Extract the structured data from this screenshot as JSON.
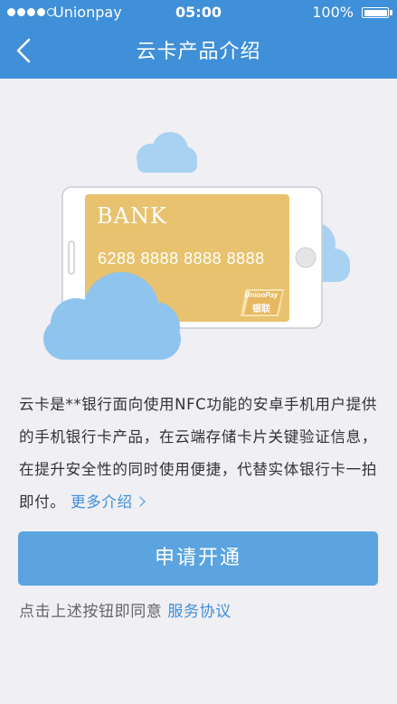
{
  "status_bar": {
    "carrier": "Unionpay",
    "time": "05:00",
    "battery": "100%"
  },
  "nav": {
    "title": "云卡产品介绍"
  },
  "card": {
    "bank_name": "BANK",
    "number": "6288 8888 8888 8888",
    "logo_en": "UnionPay",
    "logo_cn": "银联"
  },
  "description": {
    "text": "云卡是**银行面向使用NFC功能的安卓手机用户提供的手机银行卡产品，在云端存储卡片关键验证信息，在提升安全性的同时使用便捷，代替实体银行卡一拍即付。",
    "more_link": "更多介绍"
  },
  "actions": {
    "apply_label": "申请开通"
  },
  "agreement": {
    "text": "点击上述按钮即同意",
    "link": "服务协议"
  },
  "colors": {
    "header_bg": "#3f8fd9",
    "button_bg": "#5ba4df",
    "link": "#3f8fd9",
    "card_gold": "#e8c26e",
    "cloud": "#8ec4ee",
    "page_bg": "#efeff4"
  },
  "icons": {
    "back": "chevron-left-icon",
    "more": "chevron-right-icon"
  }
}
